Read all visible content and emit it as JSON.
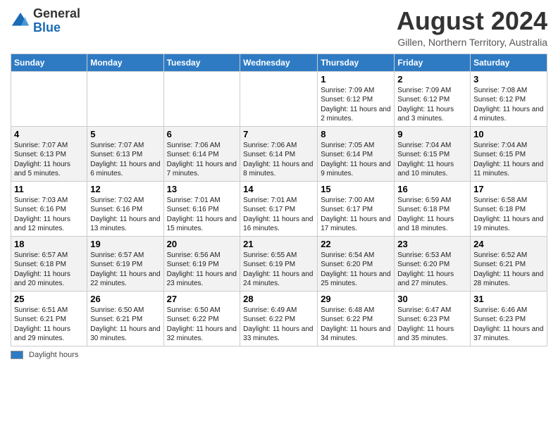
{
  "header": {
    "logo": {
      "general": "General",
      "blue": "Blue"
    },
    "month_year": "August 2024",
    "location": "Gillen, Northern Territory, Australia"
  },
  "weekdays": [
    "Sunday",
    "Monday",
    "Tuesday",
    "Wednesday",
    "Thursday",
    "Friday",
    "Saturday"
  ],
  "weeks": [
    [
      {
        "day": "",
        "info": ""
      },
      {
        "day": "",
        "info": ""
      },
      {
        "day": "",
        "info": ""
      },
      {
        "day": "",
        "info": ""
      },
      {
        "day": "1",
        "info": "Sunrise: 7:09 AM\nSunset: 6:12 PM\nDaylight: 11 hours\nand 2 minutes."
      },
      {
        "day": "2",
        "info": "Sunrise: 7:09 AM\nSunset: 6:12 PM\nDaylight: 11 hours\nand 3 minutes."
      },
      {
        "day": "3",
        "info": "Sunrise: 7:08 AM\nSunset: 6:12 PM\nDaylight: 11 hours\nand 4 minutes."
      }
    ],
    [
      {
        "day": "4",
        "info": "Sunrise: 7:07 AM\nSunset: 6:13 PM\nDaylight: 11 hours\nand 5 minutes."
      },
      {
        "day": "5",
        "info": "Sunrise: 7:07 AM\nSunset: 6:13 PM\nDaylight: 11 hours\nand 6 minutes."
      },
      {
        "day": "6",
        "info": "Sunrise: 7:06 AM\nSunset: 6:14 PM\nDaylight: 11 hours\nand 7 minutes."
      },
      {
        "day": "7",
        "info": "Sunrise: 7:06 AM\nSunset: 6:14 PM\nDaylight: 11 hours\nand 8 minutes."
      },
      {
        "day": "8",
        "info": "Sunrise: 7:05 AM\nSunset: 6:14 PM\nDaylight: 11 hours\nand 9 minutes."
      },
      {
        "day": "9",
        "info": "Sunrise: 7:04 AM\nSunset: 6:15 PM\nDaylight: 11 hours\nand 10 minutes."
      },
      {
        "day": "10",
        "info": "Sunrise: 7:04 AM\nSunset: 6:15 PM\nDaylight: 11 hours\nand 11 minutes."
      }
    ],
    [
      {
        "day": "11",
        "info": "Sunrise: 7:03 AM\nSunset: 6:16 PM\nDaylight: 11 hours\nand 12 minutes."
      },
      {
        "day": "12",
        "info": "Sunrise: 7:02 AM\nSunset: 6:16 PM\nDaylight: 11 hours\nand 13 minutes."
      },
      {
        "day": "13",
        "info": "Sunrise: 7:01 AM\nSunset: 6:16 PM\nDaylight: 11 hours\nand 15 minutes."
      },
      {
        "day": "14",
        "info": "Sunrise: 7:01 AM\nSunset: 6:17 PM\nDaylight: 11 hours\nand 16 minutes."
      },
      {
        "day": "15",
        "info": "Sunrise: 7:00 AM\nSunset: 6:17 PM\nDaylight: 11 hours\nand 17 minutes."
      },
      {
        "day": "16",
        "info": "Sunrise: 6:59 AM\nSunset: 6:18 PM\nDaylight: 11 hours\nand 18 minutes."
      },
      {
        "day": "17",
        "info": "Sunrise: 6:58 AM\nSunset: 6:18 PM\nDaylight: 11 hours\nand 19 minutes."
      }
    ],
    [
      {
        "day": "18",
        "info": "Sunrise: 6:57 AM\nSunset: 6:18 PM\nDaylight: 11 hours\nand 20 minutes."
      },
      {
        "day": "19",
        "info": "Sunrise: 6:57 AM\nSunset: 6:19 PM\nDaylight: 11 hours\nand 22 minutes."
      },
      {
        "day": "20",
        "info": "Sunrise: 6:56 AM\nSunset: 6:19 PM\nDaylight: 11 hours\nand 23 minutes."
      },
      {
        "day": "21",
        "info": "Sunrise: 6:55 AM\nSunset: 6:19 PM\nDaylight: 11 hours\nand 24 minutes."
      },
      {
        "day": "22",
        "info": "Sunrise: 6:54 AM\nSunset: 6:20 PM\nDaylight: 11 hours\nand 25 minutes."
      },
      {
        "day": "23",
        "info": "Sunrise: 6:53 AM\nSunset: 6:20 PM\nDaylight: 11 hours\nand 27 minutes."
      },
      {
        "day": "24",
        "info": "Sunrise: 6:52 AM\nSunset: 6:21 PM\nDaylight: 11 hours\nand 28 minutes."
      }
    ],
    [
      {
        "day": "25",
        "info": "Sunrise: 6:51 AM\nSunset: 6:21 PM\nDaylight: 11 hours\nand 29 minutes."
      },
      {
        "day": "26",
        "info": "Sunrise: 6:50 AM\nSunset: 6:21 PM\nDaylight: 11 hours\nand 30 minutes."
      },
      {
        "day": "27",
        "info": "Sunrise: 6:50 AM\nSunset: 6:22 PM\nDaylight: 11 hours\nand 32 minutes."
      },
      {
        "day": "28",
        "info": "Sunrise: 6:49 AM\nSunset: 6:22 PM\nDaylight: 11 hours\nand 33 minutes."
      },
      {
        "day": "29",
        "info": "Sunrise: 6:48 AM\nSunset: 6:22 PM\nDaylight: 11 hours\nand 34 minutes."
      },
      {
        "day": "30",
        "info": "Sunrise: 6:47 AM\nSunset: 6:23 PM\nDaylight: 11 hours\nand 35 minutes."
      },
      {
        "day": "31",
        "info": "Sunrise: 6:46 AM\nSunset: 6:23 PM\nDaylight: 11 hours\nand 37 minutes."
      }
    ]
  ],
  "footer": {
    "swatch_label": "Daylight hours"
  }
}
